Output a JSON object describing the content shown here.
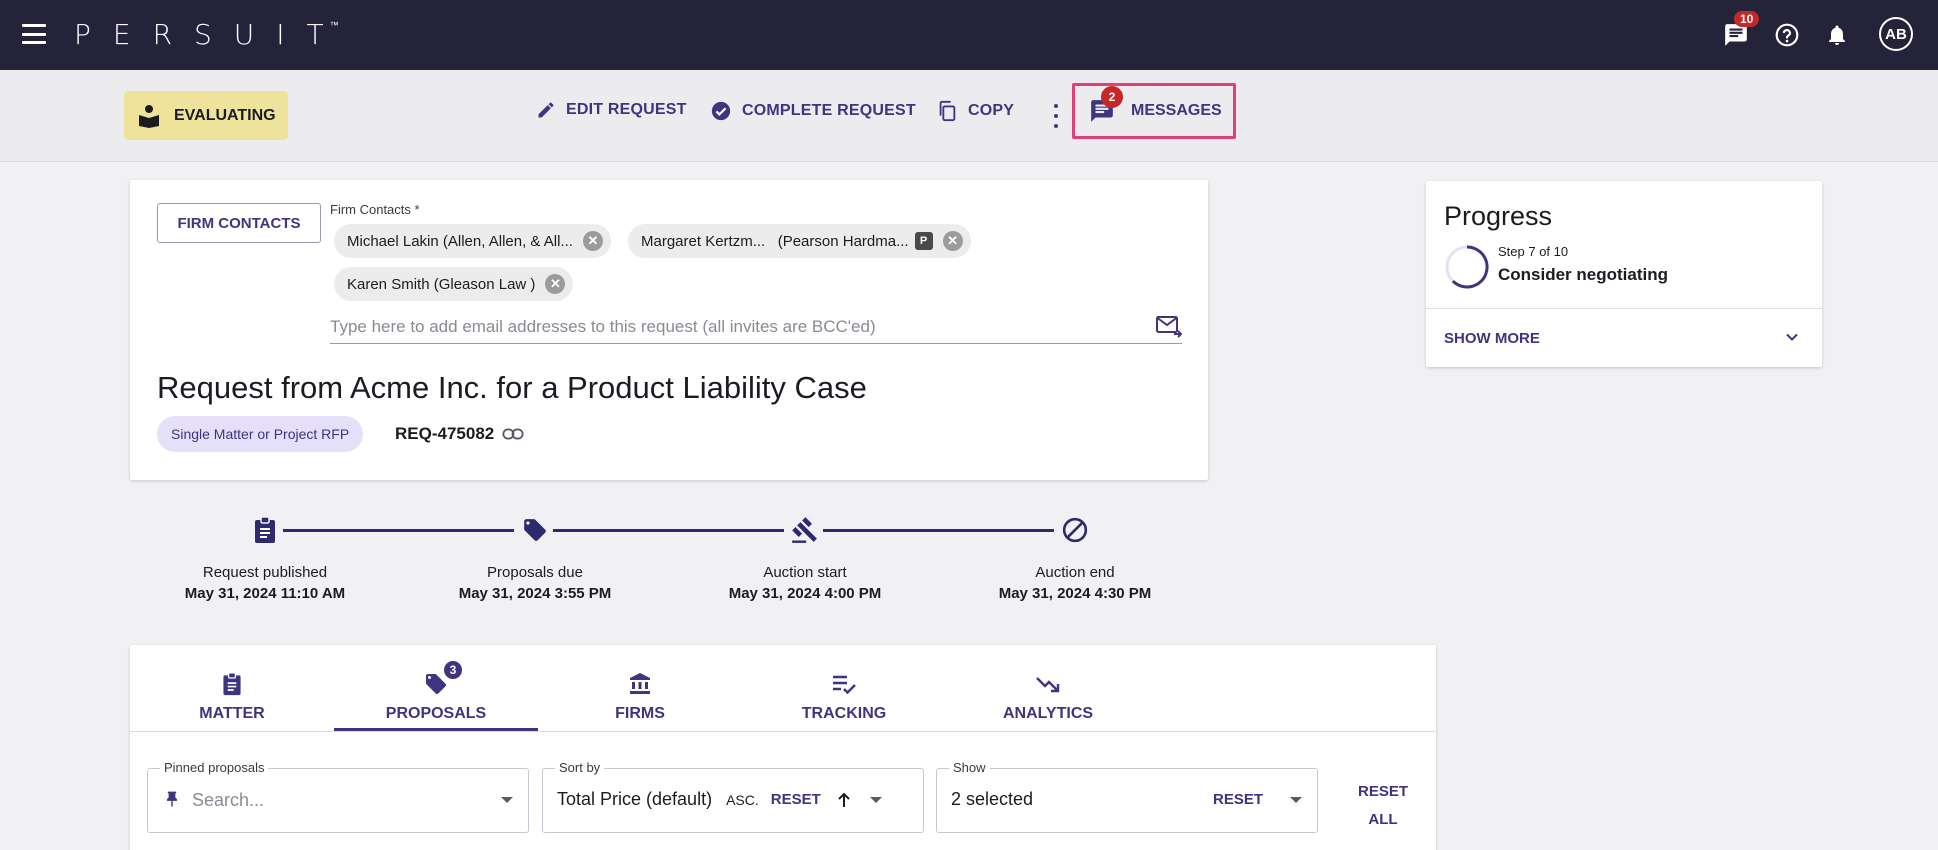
{
  "app": {
    "logo_text": "PERSUIT",
    "logo_mark": "™",
    "notifications_badge": "10",
    "avatar_initials": "AB"
  },
  "actionbar": {
    "status_label": "EVALUATING",
    "edit_label": "EDIT REQUEST",
    "complete_label": "COMPLETE REQUEST",
    "copy_label": "COPY",
    "messages_label": "MESSAGES",
    "messages_badge": "2"
  },
  "request": {
    "firm_contacts_button": "FIRM CONTACTS",
    "firm_contacts_label": "Firm Contacts *",
    "contacts": [
      {
        "name": "Michael Lakin (Allen, Allen, & All..."
      },
      {
        "name": "Margaret Kertzm...   (Pearson Hardma...",
        "tag": "P"
      },
      {
        "name": "Karen Smith (Gleason Law )"
      }
    ],
    "email_placeholder": "Type here to add email addresses to this request (all invites are BCC'ed)",
    "title": "Request from Acme Inc. for a Product Liability Case",
    "type_pill": "Single Matter or Project RFP",
    "id": "REQ-475082"
  },
  "timeline": [
    {
      "label": "Request published",
      "date": "May 31, 2024 11:10 AM"
    },
    {
      "label": "Proposals due",
      "date": "May 31, 2024 3:55 PM"
    },
    {
      "label": "Auction start",
      "date": "May 31, 2024 4:00 PM"
    },
    {
      "label": "Auction end",
      "date": "May 31, 2024 4:30 PM"
    }
  ],
  "progress": {
    "title": "Progress",
    "step": "Step 7 of 10",
    "current": "Consider negotiating",
    "show_more": "SHOW MORE"
  },
  "tabs": [
    {
      "label": "MATTER"
    },
    {
      "label": "PROPOSALS",
      "badge": "3",
      "active": true
    },
    {
      "label": "FIRMS"
    },
    {
      "label": "TRACKING"
    },
    {
      "label": "ANALYTICS"
    }
  ],
  "filters": {
    "pinned_label": "Pinned proposals",
    "pinned_placeholder": "Search...",
    "sort_label": "Sort by",
    "sort_value": "Total Price (default)",
    "sort_dir": "ASC.",
    "sort_reset": "RESET",
    "show_label": "Show",
    "show_value": "2 selected",
    "show_reset": "RESET",
    "reset_all_line1": "RESET",
    "reset_all_line2": "ALL"
  },
  "colors": {
    "topbar": "#24233a",
    "accent": "#3d3580",
    "status_chip": "#efe39c",
    "highlight_border": "#e0407a",
    "badge_red": "#c62828"
  }
}
